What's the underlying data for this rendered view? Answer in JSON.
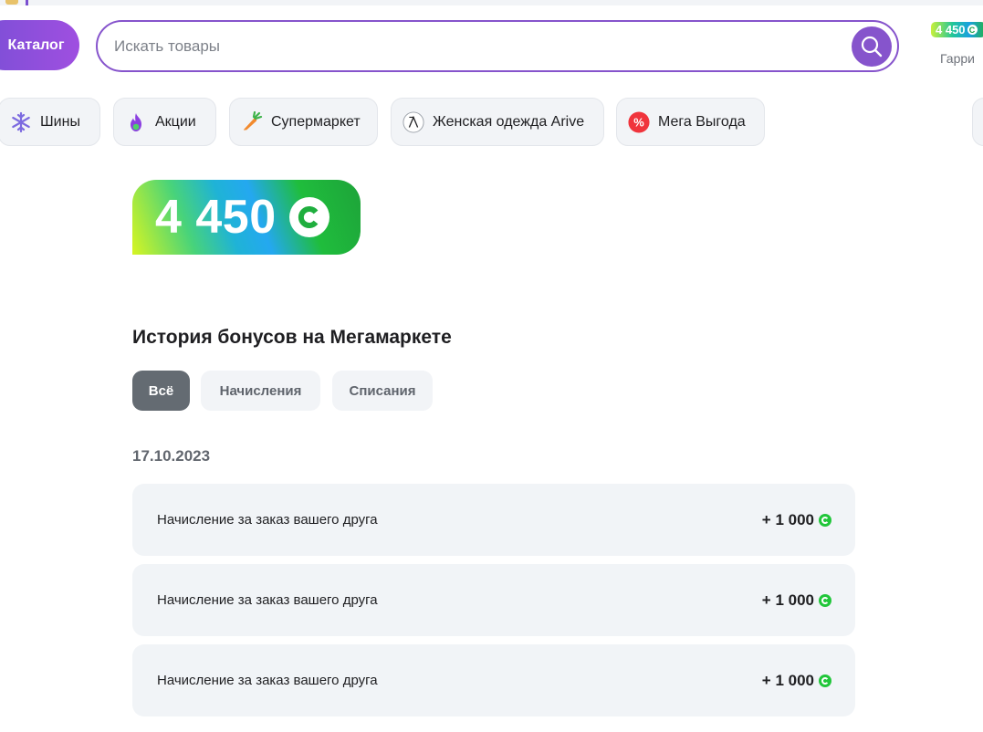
{
  "header": {
    "catalog_label": "Каталог",
    "search": {
      "placeholder": "Искать товары",
      "value": "",
      "button_icon": "search-icon"
    },
    "bonus_badge": "4 450",
    "user_name": "Гарри"
  },
  "chips": [
    {
      "label": "Шины",
      "icon": "snowflake-icon"
    },
    {
      "label": "Акции",
      "icon": "flame-icon"
    },
    {
      "label": "Супермаркет",
      "icon": "carrot-icon"
    },
    {
      "label": "Женская одежда Arive",
      "icon": "arive-logo-icon"
    },
    {
      "label": "Мега Выгода",
      "icon": "percent-icon"
    }
  ],
  "balance": {
    "value": "4 450",
    "currency_icon": "bonus-coin-icon"
  },
  "history": {
    "title": "История бонусов на Мегамаркете",
    "tabs": [
      {
        "label": "Всё",
        "active": true
      },
      {
        "label": "Начисления",
        "active": false
      },
      {
        "label": "Списания",
        "active": false
      }
    ],
    "groups": [
      {
        "date": "17.10.2023",
        "items": [
          {
            "description": "Начисление за заказ вашего друга",
            "amount": "+ 1 000"
          },
          {
            "description": "Начисление за заказ вашего друга",
            "amount": "+ 1 000"
          },
          {
            "description": "Начисление за заказ вашего друга",
            "amount": "+ 1 000"
          }
        ]
      }
    ]
  },
  "colors": {
    "brand_purple": "#8654cc",
    "bonus_green": "#21c63a",
    "active_tab": "#646b72",
    "row_bg": "#f1f4f7"
  }
}
